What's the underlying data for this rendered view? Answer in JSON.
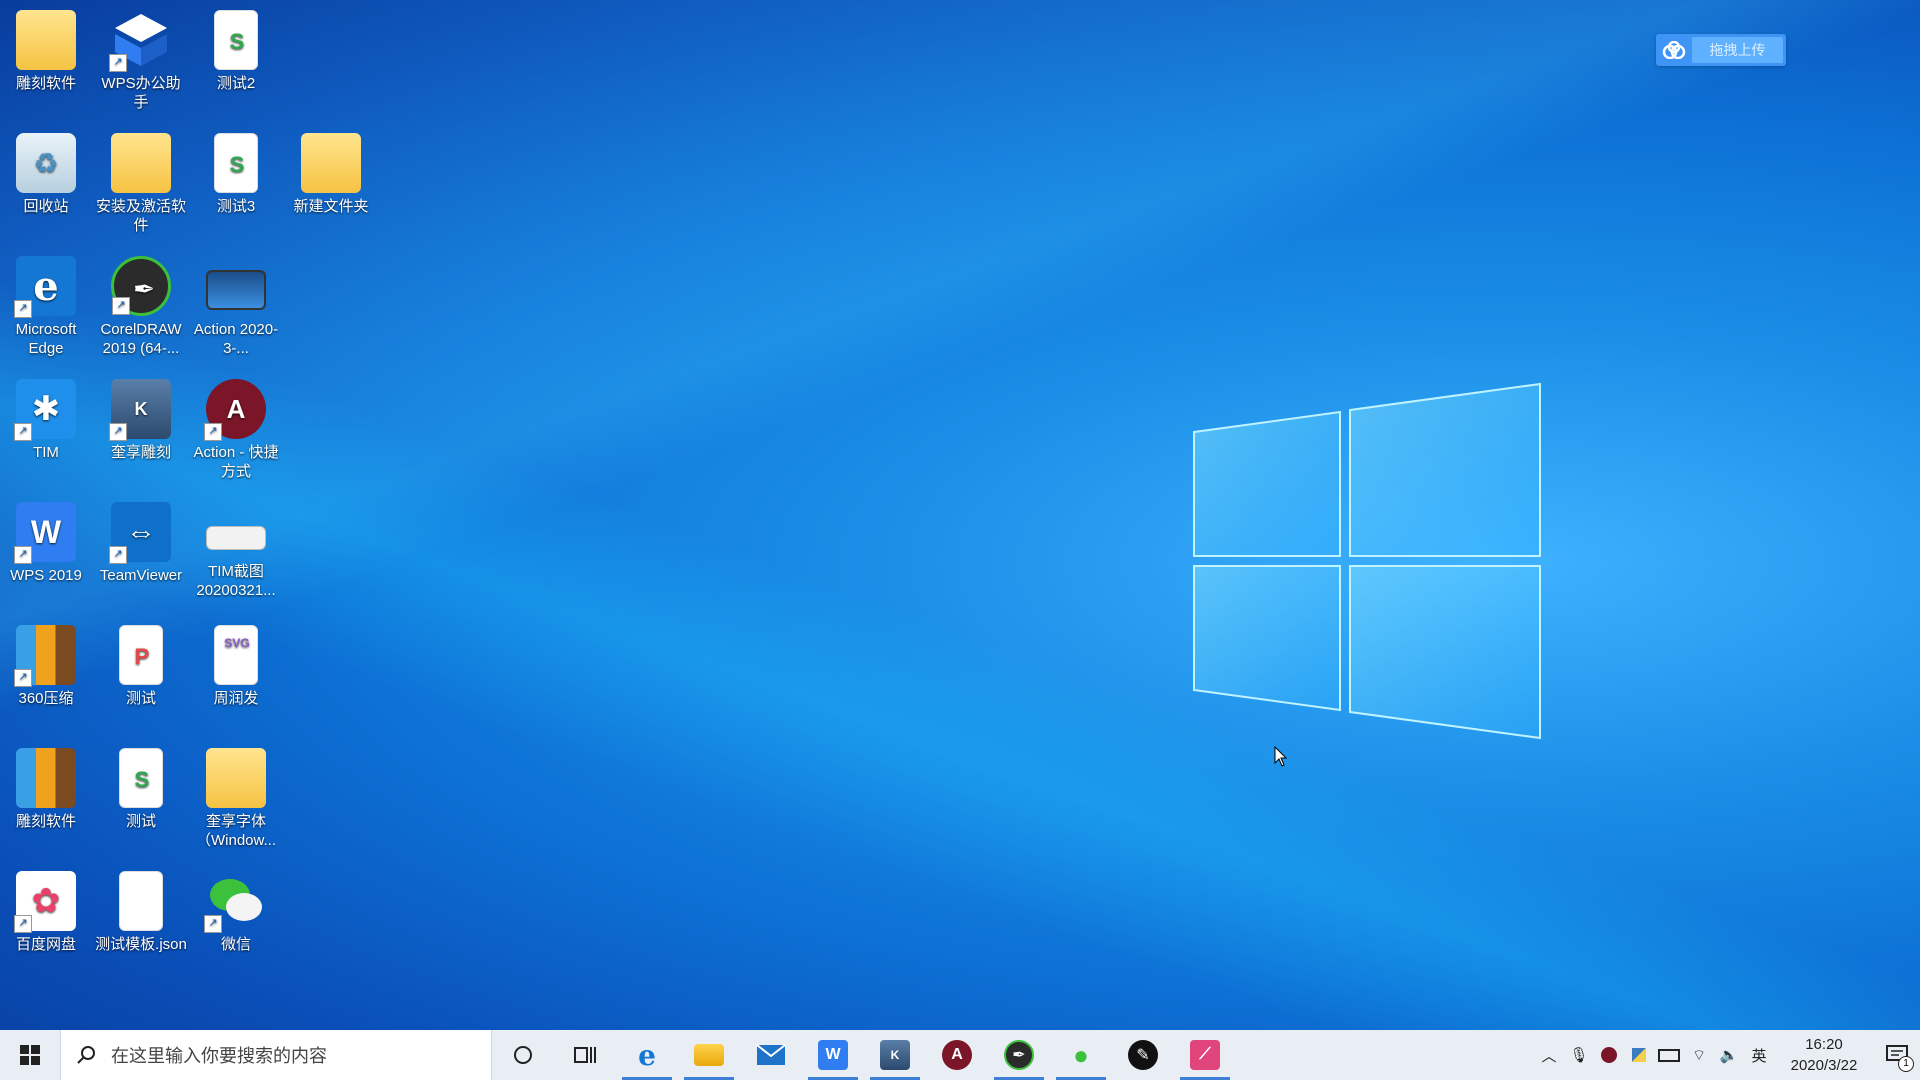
{
  "desktop": {
    "icons": [
      {
        "label": "雕刻软件"
      },
      {
        "label": "WPS办公助手"
      },
      {
        "label": "测试2"
      },
      {
        "label": "回收站"
      },
      {
        "label": "安装及激活软件"
      },
      {
        "label": "测试3"
      },
      {
        "label": "新建文件夹"
      },
      {
        "label": "Microsoft Edge"
      },
      {
        "label": "CorelDRAW 2019 (64-..."
      },
      {
        "label": "Action 2020-3-..."
      },
      {
        "label": "TIM"
      },
      {
        "label": "奎享雕刻"
      },
      {
        "label": "Action - 快捷方式"
      },
      {
        "label": "WPS 2019"
      },
      {
        "label": "TeamViewer"
      },
      {
        "label": "TIM截图20200321..."
      },
      {
        "label": "360压缩"
      },
      {
        "label": "测试"
      },
      {
        "label": "周润发"
      },
      {
        "label": "雕刻软件"
      },
      {
        "label": "测试"
      },
      {
        "label": "奎享字体（Window..."
      },
      {
        "label": "百度网盘"
      },
      {
        "label": "测试模板.json"
      },
      {
        "label": "微信"
      }
    ]
  },
  "upload_widget": {
    "label": "拖拽上传"
  },
  "taskbar": {
    "search_placeholder": "在这里输入你要搜索的内容",
    "ime_label": "英",
    "clock_time": "16:20",
    "clock_date": "2020/3/22",
    "notification_count": "1"
  },
  "colors": {
    "accent": "#3d7fd6",
    "taskbar_bg": "#e9eef5"
  }
}
